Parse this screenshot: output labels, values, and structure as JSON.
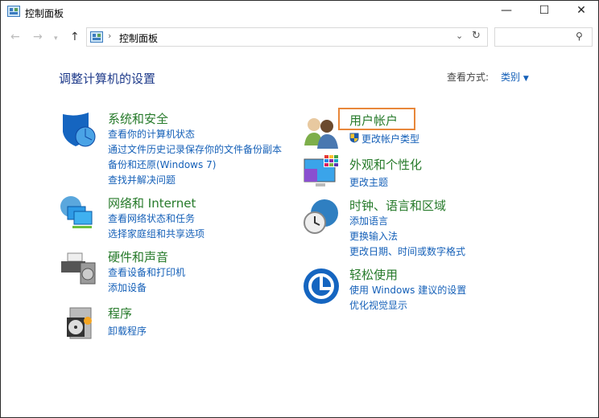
{
  "window": {
    "title": "控制面板"
  },
  "address": {
    "path": "控制面板"
  },
  "search": {
    "placeholder": ""
  },
  "main": {
    "heading": "调整计算机的设置",
    "view_by_label": "查看方式:",
    "view_by_value": "类别",
    "categories": [
      {
        "title": "系统和安全",
        "links": [
          "查看你的计算机状态",
          "通过文件历史记录保存你的文件备份副本",
          "备份和还原(Windows 7)",
          "查找并解决问题"
        ]
      },
      {
        "title": "网络和 Internet",
        "links": [
          "查看网络状态和任务",
          "选择家庭组和共享选项"
        ]
      },
      {
        "title": "硬件和声音",
        "links": [
          "查看设备和打印机",
          "添加设备"
        ]
      },
      {
        "title": "程序",
        "links": [
          "卸载程序"
        ]
      },
      {
        "title": "用户帐户",
        "links": [
          "更改帐户类型"
        ]
      },
      {
        "title": "外观和个性化",
        "links": [
          "更改主题"
        ]
      },
      {
        "title": "时钟、语言和区域",
        "links": [
          "添加语言",
          "更换输入法",
          "更改日期、时间或数字格式"
        ]
      },
      {
        "title": "轻松使用",
        "links": [
          "使用 Windows 建议的设置",
          "优化视觉显示"
        ]
      }
    ]
  },
  "colors": {
    "highlight": "#e8873a",
    "category": "#267a2a",
    "link": "#1560b8"
  }
}
